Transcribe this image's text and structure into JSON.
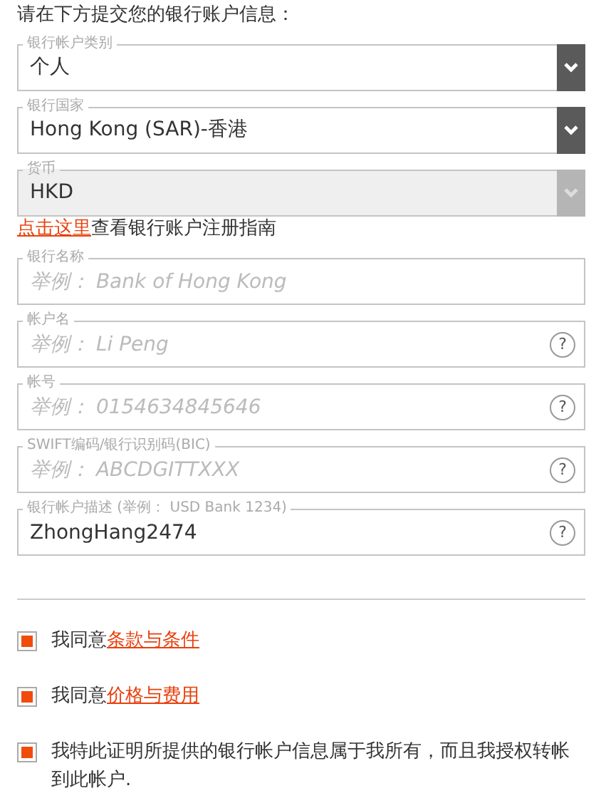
{
  "heading": "请在下方提交您的银行账户信息：",
  "selects": [
    {
      "label": "银行帐户类别",
      "value": "个人",
      "disabled": false
    },
    {
      "label": "银行国家",
      "value": "Hong Kong (SAR)-香港",
      "disabled": false
    },
    {
      "label": "货币",
      "value": "HKD",
      "disabled": true
    }
  ],
  "guide": {
    "link": "点击这里",
    "text": "查看银行账户注册指南"
  },
  "inputs": [
    {
      "label": "银行名称",
      "placeholder": "举例： Bank of Hong Kong"
    },
    {
      "label": "帐户名",
      "placeholder": "举例： Li Peng",
      "help": "?"
    },
    {
      "label": "帐号",
      "placeholder": "举例： 0154634845646",
      "help": "?"
    },
    {
      "label": "SWIFT编码/银行识别码(BIC)",
      "placeholder": "举例： ABCDGITTXXX",
      "help": "?"
    },
    {
      "label": "银行帐户描述 (举例： USD Bank 1234)",
      "value": "ZhongHang2474",
      "help": "?"
    }
  ],
  "agreements": [
    {
      "checked": true,
      "text": "我同意",
      "link": "条款与条件"
    },
    {
      "checked": true,
      "text": "我同意",
      "link": "价格与费用"
    },
    {
      "checked": true,
      "text": "我特此证明所提供的银行帐户信息属于我所有，而且我授权转帐到此帐户."
    }
  ]
}
